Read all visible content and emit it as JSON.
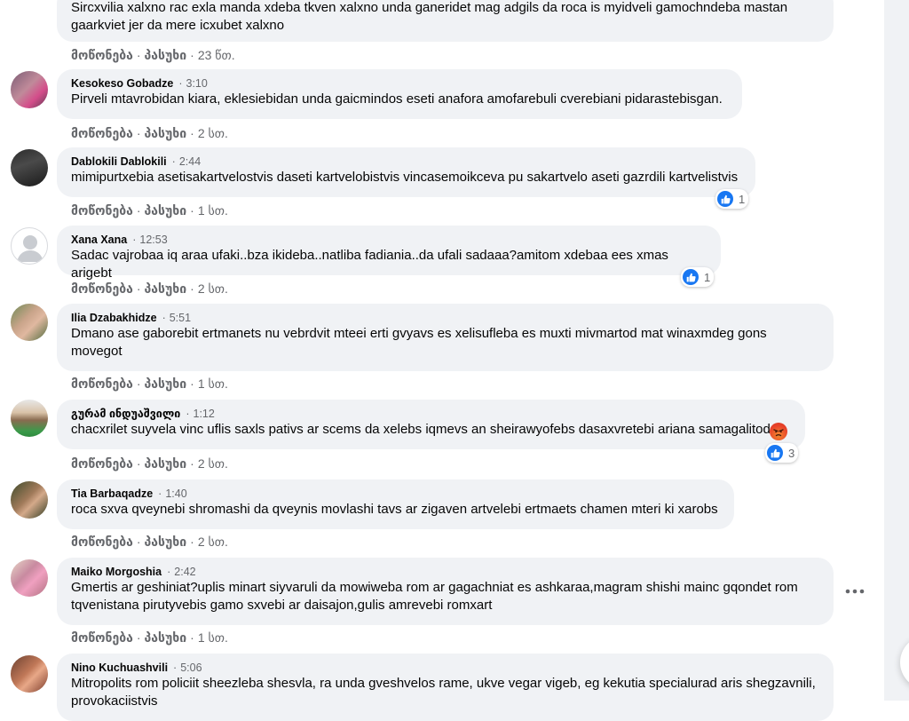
{
  "actions": {
    "like": "მოწონება",
    "reply": "პასუხი"
  },
  "comments": [
    {
      "author": "",
      "time": "",
      "text1": "Sircxvilia xalxno rac exla manda xdeba tkven xalxno unda ganeridet mag adgils da roca is myidveli gamochndeba mastan",
      "text2": "gaarkviet jer da mere icxubet xalxno",
      "ago": "23 წთ."
    },
    {
      "author": "Kesokeso Gobadze",
      "time": "3:10",
      "text1": "Pirveli mtavrobidan kiara, eklesiebidan unda gaicmindos eseti anafora amofarebuli cverebiani pidarastebisgan.",
      "ago": "2 სთ."
    },
    {
      "author": "Dablokili Dablokili",
      "time": "2:44",
      "text1": "mimipurtxebia asetisakartvelostvis daseti kartvelobistvis vincasemoikceva pu sakartvelo aseti gazrdili kartvelistvis",
      "ago": "1 სთ.",
      "likes": "1"
    },
    {
      "author": "Xana Xana",
      "time": "12:53",
      "text1": "Sadac vajrobaa iq araa ufaki..bza ikideba..natliba fadiania..da ufali sadaaa?amitom xdebaa ees xmas arigebt",
      "ago": "2 სთ.",
      "likes": "1"
    },
    {
      "author": "Ilia Dzabakhidze",
      "time": "5:51",
      "text1": "Dmano ase gaborebit ertmanets nu vebrdvit mteei erti gvyavs es xelisufleba es muxti mivmartod mat winaxmdeg gons",
      "text2": "movegot",
      "ago": "1 სთ."
    },
    {
      "author": "გურამ ინდუაშვილი",
      "time": "1:12",
      "text1": "chacxrilet suyvela vinc uflis saxls pativs ar scems da xelebs iqmevs an sheirawyofebs dasaxvretebi ariana samagalitod",
      "ago": "2 სთ.",
      "likes": "3"
    },
    {
      "author": "Tia Barbaqadze",
      "time": "1:40",
      "text1": "roca sxva qveynebi shromashi da qveynis movlashi tavs ar zigaven artvelebi ertmaets chamen mteri ki xarobs",
      "ago": "2 სთ."
    },
    {
      "author": "Maiko Morgoshia",
      "time": "2:42",
      "text1": "Gmertis ar geshiniat?uplis minart siyvaruli da mowiweba rom ar gagachniat es ashkaraa,magram shishi mainc gqondet rom",
      "text2": "tqvenistana pirutyvebis gamo sxvebi ar daisajon,gulis amrevebi romxart",
      "ago": "1 სთ."
    },
    {
      "author": "Nino Kuchuashvili",
      "time": "5:06",
      "text1": "Mitropolits rom policiit sheezleba shesvla, ra unda gveshvelos rame, ukve vegar vigeb, eg kekutia specialurad aris shegzavnili,",
      "text2": "provokaciistvis"
    }
  ],
  "colors": {
    "bubble": "#f0f2f5",
    "like_blue": "#1877f2",
    "meta_gray": "#65676b"
  },
  "icons": [
    "like-icon",
    "angry-reaction-icon",
    "more-options-icon",
    "default-avatar-icon"
  ]
}
